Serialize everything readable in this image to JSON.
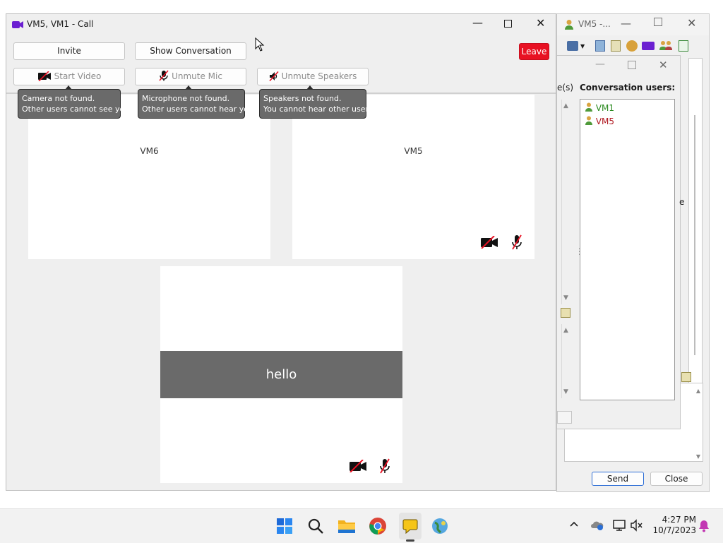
{
  "bg_window": {
    "title": "VM5 -...",
    "partial_text_1": "e(s)",
    "partial_text_2": "e",
    "users_header": "Conversation users:",
    "users": [
      {
        "name": "VM1",
        "color": "#2a8a1f"
      },
      {
        "name": "VM5",
        "color": "#b0171f"
      }
    ],
    "send_label": "Send",
    "close_label": "Close"
  },
  "call_window": {
    "title": "VM5, VM1 - Call",
    "invite_label": "Invite",
    "show_conversation_label": "Show Conversation",
    "leave_label": "Leave",
    "start_video_label": "Start Video",
    "unmute_mic_label": "Unmute Mic",
    "unmute_speakers_label": "Unmute Speakers",
    "tooltips": {
      "camera": [
        "Camera not found.",
        "Other users cannot see you."
      ],
      "mic": [
        "Microphone not found.",
        "Other users cannot hear you."
      ],
      "speakers": [
        "Speakers not found.",
        "You cannot hear other users."
      ]
    },
    "tiles": [
      {
        "name": "VM6"
      },
      {
        "name": "VM5"
      },
      {
        "name": "",
        "overlay_text": "hello"
      }
    ]
  },
  "taskbar": {
    "time": "4:27 PM",
    "date": "10/7/2023"
  },
  "colors": {
    "leave": "#e81123",
    "call_icon": "#6b1fd1",
    "hello_band": "#6a6a6a"
  }
}
